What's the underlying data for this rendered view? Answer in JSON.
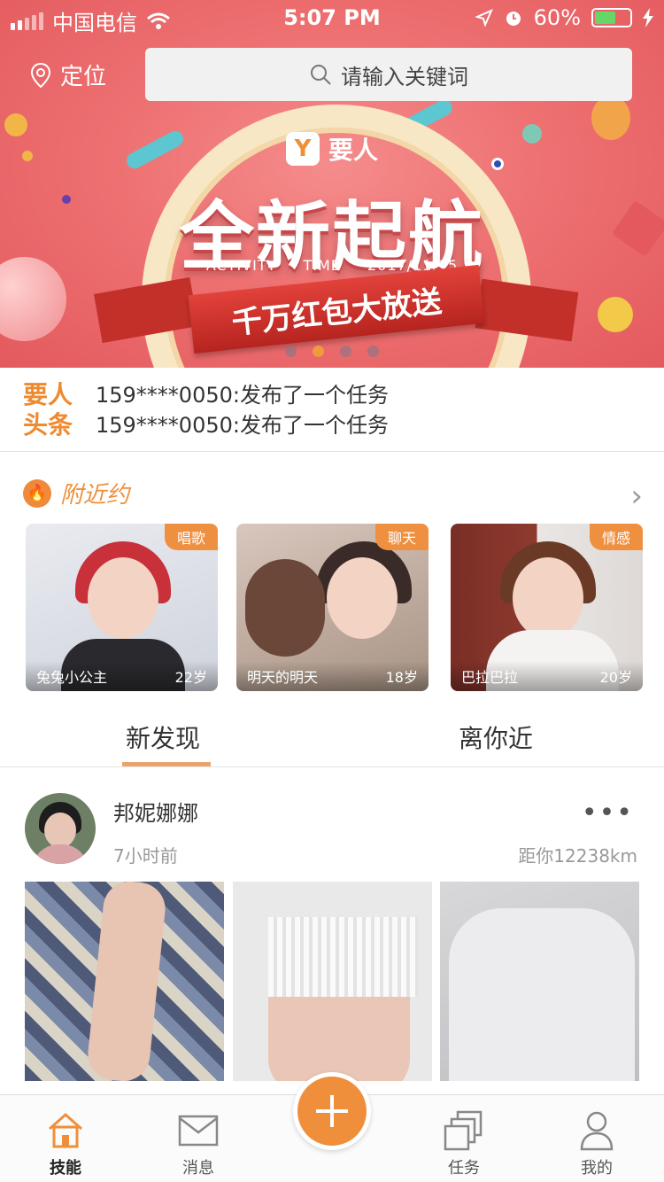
{
  "status_bar": {
    "carrier": "中国电信",
    "time": "5:07 PM",
    "battery": "60%"
  },
  "header": {
    "location_label": "定位",
    "search_placeholder": "请输入关键词"
  },
  "banner": {
    "logo_text": "要人",
    "logo_mark": "Y",
    "headline": "全新起航",
    "activity_label": "ACTIVITY TIME",
    "activity_date": "2017/11/15",
    "ribbon_text": "千万红包大放送",
    "pages": 4,
    "active_page": 2
  },
  "news": {
    "logo_line1": "要人",
    "logo_line2": "头条",
    "items": [
      "159****0050:发布了一个任务",
      "159****0050:发布了一个任务"
    ]
  },
  "nearby": {
    "title": "附近约",
    "more_icon": "chevron-right-icon",
    "cards": [
      {
        "name": "兔兔小公主",
        "age": "22岁",
        "tag": "唱歌"
      },
      {
        "name": "明天的明天",
        "age": "18岁",
        "tag": "聊天"
      },
      {
        "name": "巴拉巴拉",
        "age": "20岁",
        "tag": "情感"
      }
    ]
  },
  "tabs": {
    "discover": "新发现",
    "nearby": "离你近",
    "active": "discover"
  },
  "post": {
    "author": "邦妮娜娜",
    "time": "7小时前",
    "distance": "距你12238km",
    "more": "•••"
  },
  "bottom_nav": {
    "items": [
      {
        "label": "技能",
        "icon": "home-icon"
      },
      {
        "label": "消息",
        "icon": "mail-icon"
      },
      {
        "label": "任务",
        "icon": "stack-icon"
      },
      {
        "label": "我的",
        "icon": "user-icon"
      }
    ],
    "fab_icon": "plus-icon",
    "active": "技能"
  },
  "colors": {
    "accent": "#ef8f3c",
    "banner": "#ee7172"
  }
}
